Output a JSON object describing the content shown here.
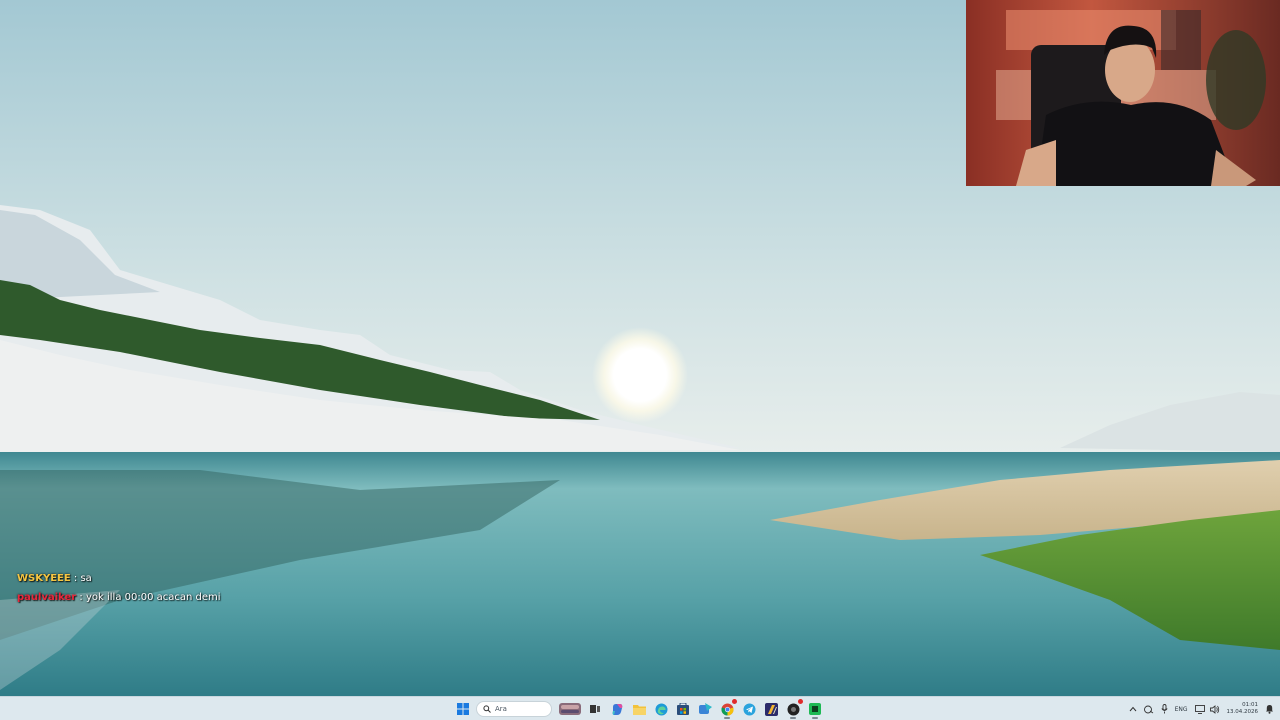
{
  "chat": {
    "messages": [
      {
        "user": "WSKYEEE",
        "separator": " : ",
        "text": "sa",
        "color": "#f5c542"
      },
      {
        "user": "paulvaiker",
        "separator": " : ",
        "text": "yok illa 00:00 acacan demi",
        "color": "#e8283c"
      }
    ]
  },
  "taskbar": {
    "search_placeholder": "Ara",
    "icons": [
      "windows-start-icon",
      "search-icon",
      "widgets-icon",
      "task-view-icon",
      "copilot-icon",
      "file-explorer-icon",
      "edge-browser-icon",
      "microsoft-store-icon",
      "app-icon",
      "chrome-icon",
      "telegram-icon",
      "app-icon",
      "app-icon",
      "app-icon"
    ],
    "tray": {
      "language": "ENG",
      "time": "01:01",
      "date": "13.04.2026"
    }
  },
  "colors": {
    "taskbar_bg": "#dde8ee",
    "sky": "#a9ccd5",
    "water": "#5fa7ad"
  }
}
